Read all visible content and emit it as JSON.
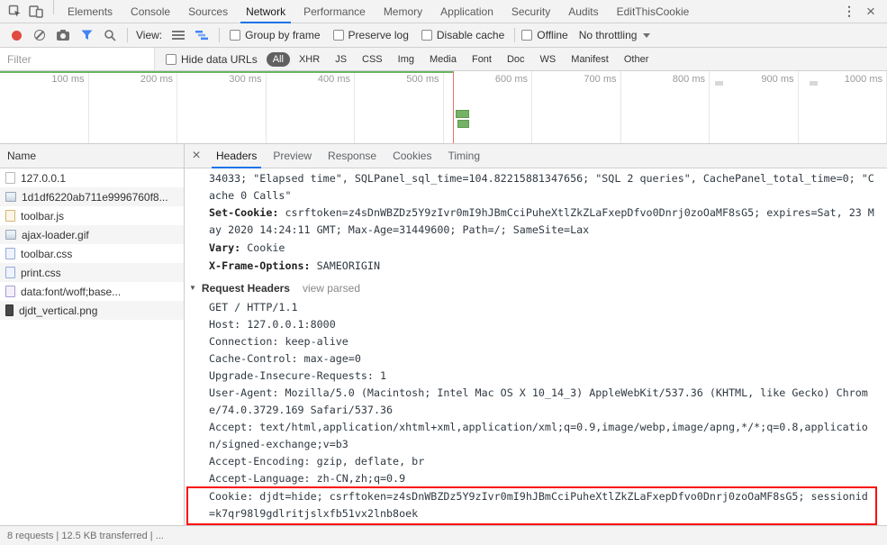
{
  "colors": {
    "toolbar_bg": "#f3f3f3",
    "accent_blue": "#1a73e8",
    "funnel_blue": "#4285f4",
    "record_red": "#e04a3f",
    "waterfall_green": "#74b266",
    "selected_pill_bg": "#616161",
    "highlight_red": "#fb0d0d"
  },
  "main_tabs": {
    "menu_icon": "⋮",
    "close_icon": "×",
    "items": [
      {
        "label": "Elements"
      },
      {
        "label": "Console"
      },
      {
        "label": "Sources"
      },
      {
        "label": "Network",
        "active": true
      },
      {
        "label": "Performance"
      },
      {
        "label": "Memory"
      },
      {
        "label": "Application"
      },
      {
        "label": "Security"
      },
      {
        "label": "Audits"
      },
      {
        "label": "EditThisCookie"
      }
    ]
  },
  "toolbar": {
    "view_label": "View:",
    "checkboxes": [
      {
        "label": "Group by frame"
      },
      {
        "label": "Preserve log"
      },
      {
        "label": "Disable cache"
      }
    ],
    "offline_label": "Offline",
    "throttling_label": "No throttling"
  },
  "filter_bar": {
    "filter_placeholder": "Filter",
    "hide_data_urls_label": "Hide data URLs",
    "pills": [
      {
        "label": "All",
        "active": true
      },
      {
        "label": "XHR"
      },
      {
        "label": "JS"
      },
      {
        "label": "CSS"
      },
      {
        "label": "Img"
      },
      {
        "label": "Media"
      },
      {
        "label": "Font"
      },
      {
        "label": "Doc"
      },
      {
        "label": "WS"
      },
      {
        "label": "Manifest"
      },
      {
        "label": "Other"
      }
    ]
  },
  "timeline": {
    "ticks": [
      "100 ms",
      "200 ms",
      "300 ms",
      "400 ms",
      "500 ms",
      "600 ms",
      "700 ms",
      "800 ms",
      "900 ms",
      "1000 ms"
    ]
  },
  "request_list": {
    "header": "Name",
    "items": [
      {
        "name": "127.0.0.1",
        "type": "document"
      },
      {
        "name": "1d1df6220ab711e9996760f8...",
        "type": "image"
      },
      {
        "name": "toolbar.js",
        "type": "script"
      },
      {
        "name": "ajax-loader.gif",
        "type": "image"
      },
      {
        "name": "toolbar.css",
        "type": "stylesheet"
      },
      {
        "name": "print.css",
        "type": "stylesheet"
      },
      {
        "name": "data:font/woff;base...",
        "type": "font"
      },
      {
        "name": "djdt_vertical.png",
        "type": "image-dark"
      }
    ]
  },
  "details": {
    "close_icon": "×",
    "disclosure_icon": "▼",
    "tabs": [
      {
        "label": "Headers",
        "active": true
      },
      {
        "label": "Preview"
      },
      {
        "label": "Response"
      },
      {
        "label": "Cookies"
      },
      {
        "label": "Timing"
      }
    ],
    "response_overflow": "34033; \"Elapsed time\", SQLPanel_sql_time=104.82215881347656; \"SQL 2 queries\", CachePanel_total_time=0; \"Cache 0 Calls\"",
    "response_headers": [
      {
        "name": "Set-Cookie:",
        "value": "csrftoken=z4sDnWBZDz5Y9zIvr0mI9hJBmCciPuheXtlZkZLaFxepDfvo0Dnrj0zoOaMF8sG5; expires=Sat, 23 May 2020 14:24:11 GMT; Max-Age=31449600; Path=/; SameSite=Lax"
      },
      {
        "name": "Vary:",
        "value": "Cookie"
      },
      {
        "name": "X-Frame-Options:",
        "value": "SAMEORIGIN"
      }
    ],
    "request_headers_title": "Request Headers",
    "view_parsed_label": "view parsed",
    "request_lines": [
      {
        "text": "GET / HTTP/1.1"
      },
      {
        "text": "Host: 127.0.0.1:8000"
      },
      {
        "text": "Connection: keep-alive"
      },
      {
        "text": "Cache-Control: max-age=0"
      },
      {
        "text": "Upgrade-Insecure-Requests: 1"
      },
      {
        "text": "User-Agent: Mozilla/5.0 (Macintosh; Intel Mac OS X 10_14_3) AppleWebKit/537.36 (KHTML, like Gecko) Chrome/74.0.3729.169 Safari/537.36"
      },
      {
        "text": "Accept: text/html,application/xhtml+xml,application/xml;q=0.9,image/webp,image/apng,*/*;q=0.8,application/signed-exchange;v=b3"
      },
      {
        "text": "Accept-Encoding: gzip, deflate, br"
      },
      {
        "text": "Accept-Language: zh-CN,zh;q=0.9"
      },
      {
        "text": "Cookie: djdt=hide; csrftoken=z4sDnWBZDz5Y9zIvr0mI9hJBmCciPuheXtlZkZLaFxepDfvo0Dnrj0zoOaMF8sG5; sessionid=k7qr98l9gdlritjslxfb51vx2lnb8oek",
        "highlight": true
      }
    ]
  },
  "status_bar": {
    "summary": "8 requests | 12.5 KB transferred | ..."
  }
}
